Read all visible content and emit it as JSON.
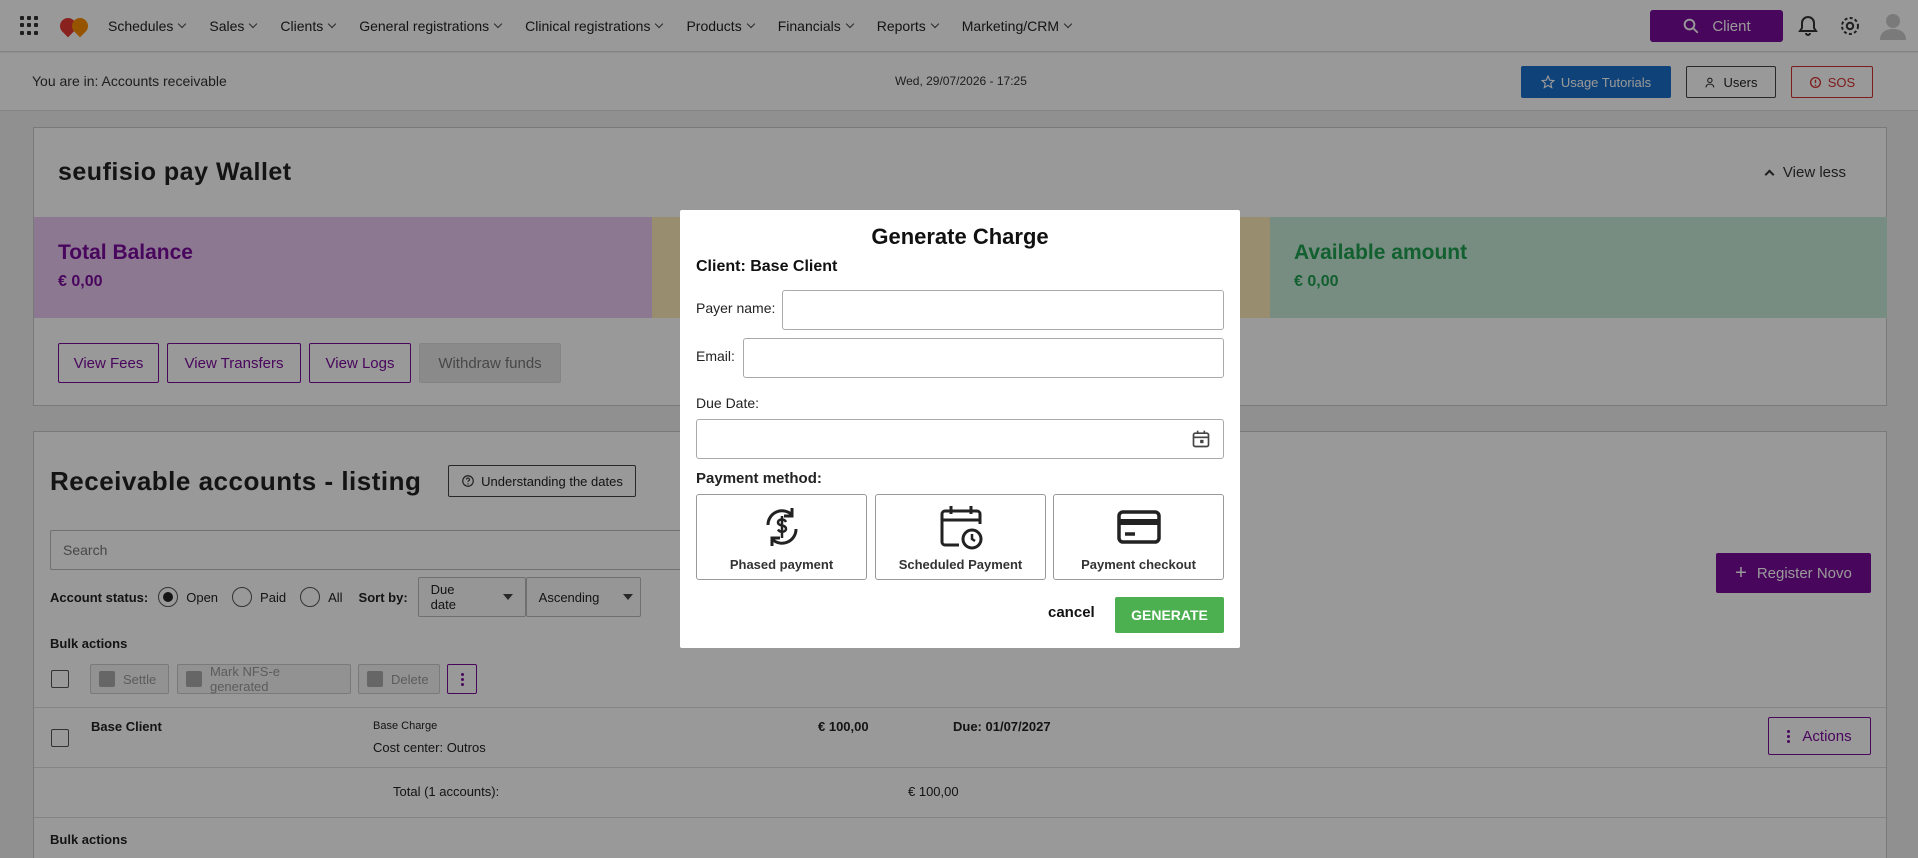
{
  "nav": {
    "menu": [
      {
        "label": "Schedules"
      },
      {
        "label": "Sales"
      },
      {
        "label": "Clients"
      },
      {
        "label": "General registrations"
      },
      {
        "label": "Clinical registrations"
      },
      {
        "label": "Products"
      },
      {
        "label": "Financials"
      },
      {
        "label": "Reports"
      },
      {
        "label": "Marketing/CRM"
      }
    ],
    "client_button": "Client",
    "accent_color": "#7a0b9c"
  },
  "subheader": {
    "breadcrumb": "You are in: Accounts receivable",
    "datetime": "Wed, 29/07/2026 - 17:25",
    "tutorials": "Usage Tutorials",
    "users": "Users",
    "sos": "SOS"
  },
  "wallet": {
    "title": "seufisio pay Wallet",
    "view_less": "View less",
    "total_label": "Total Balance",
    "total_amount": "€ 0,00",
    "available_label": "Available amount",
    "available_amount": "€ 0,00",
    "buttons": {
      "fees": "View Fees",
      "transfers": "View Transfers",
      "logs": "View Logs",
      "withdraw": "Withdraw funds"
    }
  },
  "listing": {
    "title": "Receivable accounts - listing",
    "understanding_dates": "Understanding the dates",
    "search_placeholder": "Search",
    "register_new": "Register Novo",
    "account_status_label": "Account status:",
    "status_options": [
      "Open",
      "Paid",
      "All"
    ],
    "sort_by_label": "Sort by:",
    "sort_field": "Due date",
    "sort_order": "Ascending",
    "bulk_actions_label": "Bulk actions",
    "bulk": {
      "settle": "Settle",
      "mark_nfse": "Mark NFS-e generated",
      "delete": "Delete"
    },
    "rows": [
      {
        "client": "Base Client",
        "charge": "Base Charge",
        "cost_center": "Cost center: Outros",
        "amount": "€ 100,00",
        "due": "Due: 01/07/2027",
        "actions": "Actions"
      }
    ],
    "total_label": "Total (1 accounts):",
    "total_amount": "€ 100,00"
  },
  "modal": {
    "title": "Generate Charge",
    "client": "Client: Base Client",
    "payer_name_label": "Payer name:",
    "payer_name_value": "",
    "email_label": "Email:",
    "email_value": "",
    "due_date_label": "Due Date:",
    "due_date_value": "",
    "payment_method_label": "Payment method:",
    "methods": [
      {
        "label": "Phased payment",
        "icon": "phased-payment-icon"
      },
      {
        "label": "Scheduled Payment",
        "icon": "scheduled-payment-icon"
      },
      {
        "label": "Payment checkout",
        "icon": "credit-card-icon"
      }
    ],
    "cancel": "cancel",
    "generate": "GENERATE"
  }
}
